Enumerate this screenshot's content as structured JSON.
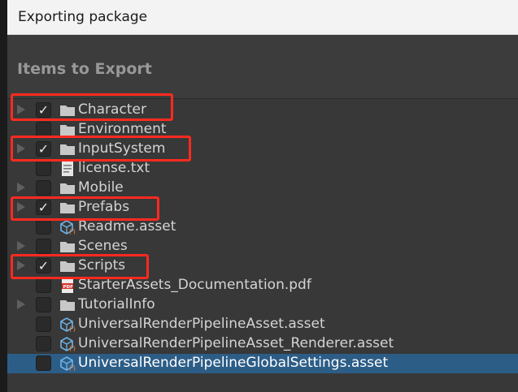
{
  "window": {
    "title": "Exporting package"
  },
  "section": {
    "header": "Items to Export"
  },
  "check_glyph": "✓",
  "items": [
    {
      "label": "Character",
      "icon": "folder-icon",
      "checked": true,
      "expandable": true,
      "highlighted": true
    },
    {
      "label": "Environment",
      "icon": "folder-icon",
      "checked": false,
      "expandable": false,
      "highlighted": false
    },
    {
      "label": "InputSystem",
      "icon": "folder-icon",
      "checked": true,
      "expandable": true,
      "highlighted": true
    },
    {
      "label": "license.txt",
      "icon": "text-file-icon",
      "checked": false,
      "expandable": false,
      "highlighted": false
    },
    {
      "label": "Mobile",
      "icon": "folder-icon",
      "checked": false,
      "expandable": true,
      "highlighted": false
    },
    {
      "label": "Prefabs",
      "icon": "folder-icon",
      "checked": true,
      "expandable": true,
      "highlighted": true
    },
    {
      "label": "Readme.asset",
      "icon": "scriptable-asset-icon",
      "checked": false,
      "expandable": false,
      "highlighted": false
    },
    {
      "label": "Scenes",
      "icon": "folder-icon",
      "checked": false,
      "expandable": true,
      "highlighted": false
    },
    {
      "label": "Scripts",
      "icon": "folder-icon",
      "checked": true,
      "expandable": true,
      "highlighted": true
    },
    {
      "label": "StarterAssets_Documentation.pdf",
      "icon": "pdf-icon",
      "checked": false,
      "expandable": false,
      "highlighted": false
    },
    {
      "label": "TutorialInfo",
      "icon": "folder-icon",
      "checked": false,
      "expandable": true,
      "highlighted": false
    },
    {
      "label": "UniversalRenderPipelineAsset.asset",
      "icon": "scriptable-asset-icon",
      "checked": false,
      "expandable": false,
      "highlighted": false
    },
    {
      "label": "UniversalRenderPipelineAsset_Renderer.asset",
      "icon": "scriptable-asset-icon",
      "checked": false,
      "expandable": false,
      "highlighted": false
    },
    {
      "label": "UniversalRenderPipelineGlobalSettings.asset",
      "icon": "scriptable-asset-icon",
      "checked": false,
      "expandable": false,
      "highlighted": false,
      "selected": true
    }
  ],
  "colors": {
    "highlight": "#ff2a1f",
    "selection": "#2c5d87"
  }
}
